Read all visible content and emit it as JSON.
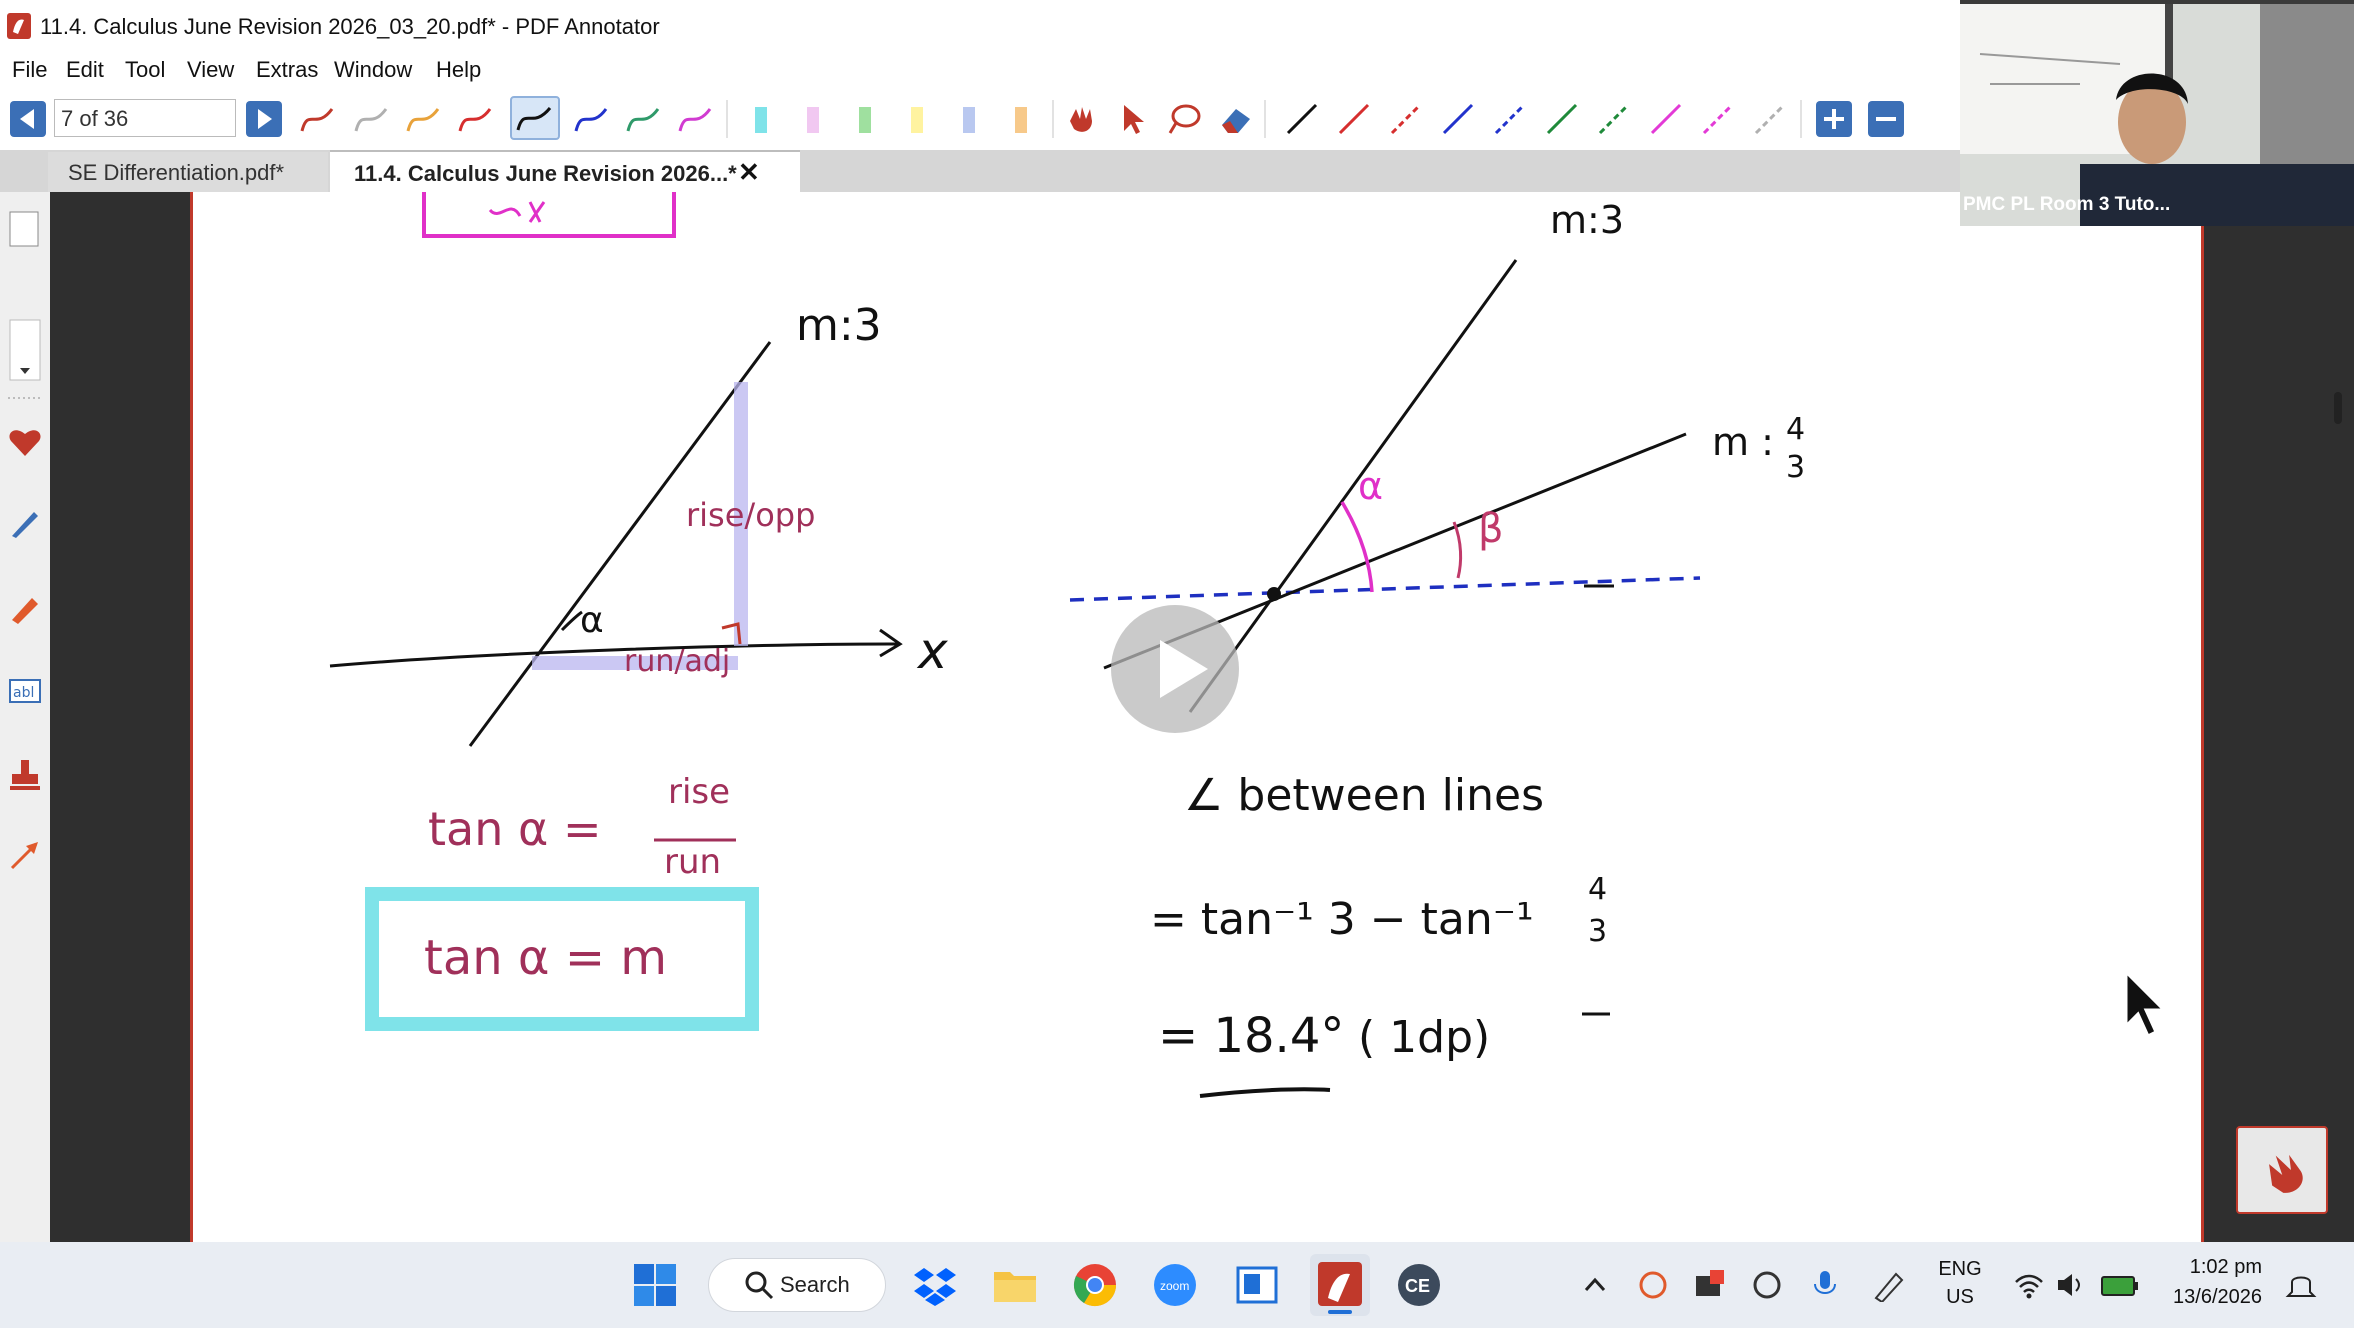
{
  "window": {
    "title": "11.4. Calculus June Revision 2026_03_20.pdf* - PDF Annotator"
  },
  "menu": [
    "File",
    "Edit",
    "Tool",
    "View",
    "Extras",
    "Window",
    "Help"
  ],
  "toolbar": {
    "page_indicator": "7 of 36",
    "prev_icon": "prev-page-icon",
    "next_icon": "next-page-icon",
    "pen_colors": [
      "#c0392b",
      "#b0b0b0",
      "#e8a23a",
      "#d62e2e",
      "#111111",
      "#2233cc",
      "#2f9a6a",
      "#d13bd1"
    ],
    "highlighter_colors": [
      "#7fe3e9",
      "#f1c8f1",
      "#9fe09f",
      "#fff3a0",
      "#b9c8f0",
      "#f7c98a"
    ],
    "line_colors": [
      "#111111",
      "#d62e2e",
      "#d62e2e",
      "#2233cc",
      "#2233cc",
      "#1f8a3a",
      "#1f8a3a",
      "#e33ad6",
      "#e33ad6",
      "#b0b0b0"
    ]
  },
  "tabs": [
    {
      "label": "SE Differentiation.pdf*",
      "active": false
    },
    {
      "label": "11.4. Calculus June Revision 2026...*",
      "active": true
    }
  ],
  "tab_close": "✕",
  "webcam": {
    "label": "PMC PL Room 3 Tuto..."
  },
  "ink": {
    "left_gradient_label": "m:3",
    "right_top_gradient_label": "m:3",
    "right_lower_gradient_m": "m :",
    "frac_num": "4",
    "frac_den": "3",
    "x_axis": "x",
    "rise_opp": "rise/opp",
    "run_adj": "run/adj",
    "alpha_left": "α",
    "alpha_right": "α",
    "beta": "β",
    "eq1_lhs": "tan α =",
    "eq1_num": "rise",
    "eq1_den": "run",
    "boxed_eq": "tan α = m",
    "angle_between": "∠ between lines",
    "eq2_part1": "= tan⁻¹ 3  −  tan⁻¹",
    "eq2_num": "4",
    "eq2_den": "3",
    "answer": "= 18.4°",
    "answer_note": "( 1dp)"
  },
  "taskbar": {
    "search_label": "Search",
    "lang_line1": "ENG",
    "lang_line2": "US",
    "time": "1:02 pm",
    "date": "13/6/2026"
  }
}
